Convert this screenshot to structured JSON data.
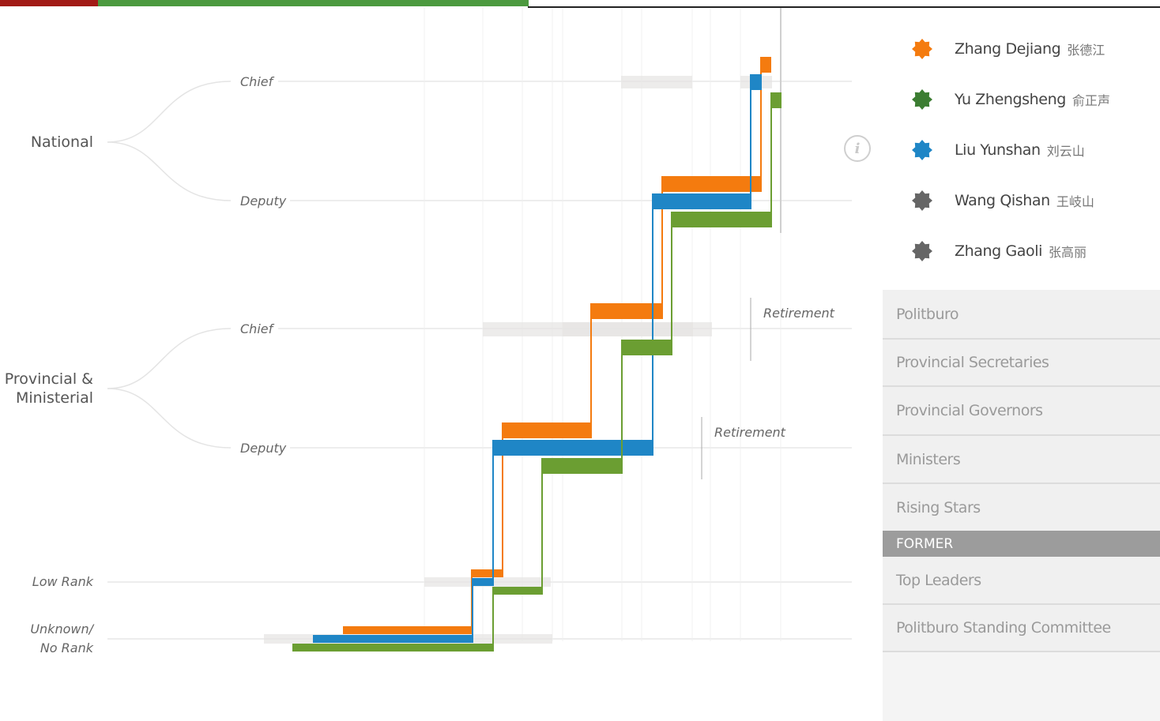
{
  "top_bar": {
    "colors": [
      "#a21b16",
      "#4c9a3f"
    ]
  },
  "chart_data": {
    "type": "step",
    "levels": [
      {
        "group": "National",
        "sub": "Chief"
      },
      {
        "group": "National",
        "sub": "Deputy"
      },
      {
        "group": "Provincial & Ministerial",
        "sub": "Chief"
      },
      {
        "group": "Provincial & Ministerial",
        "sub": "Deputy"
      },
      {
        "group": "",
        "sub": "Low Rank"
      },
      {
        "group": "",
        "sub": "Unknown/ No Rank"
      }
    ],
    "group_labels": {
      "national": "National",
      "provincial_line1": "Provincial &",
      "provincial_line2": "Ministerial"
    },
    "tier_labels": {
      "chief": "Chief",
      "deputy": "Deputy"
    },
    "rank_labels": {
      "low_rank": "Low Rank",
      "unknown_line1": "Unknown/",
      "unknown_line2": "No Rank"
    },
    "annotations": [
      "Retirement",
      "Retirement"
    ],
    "series": [
      {
        "name": "Zhang Dejiang",
        "color": "#f47b0f"
      },
      {
        "name": "Liu Yunshan",
        "color": "#1f86c6"
      },
      {
        "name": "Yu Zhengsheng",
        "color": "#6b9e32"
      }
    ]
  },
  "legend": {
    "items": [
      {
        "name": "Zhang Dejiang",
        "cn": "张德江",
        "color": "#f47b0f"
      },
      {
        "name": "Yu Zhengsheng",
        "cn": "俞正声",
        "color": "#3c7d32"
      },
      {
        "name": "Liu Yunshan",
        "cn": "刘云山",
        "color": "#1f86c6"
      },
      {
        "name": "Wang Qishan",
        "cn": "王岐山",
        "color": "#666666"
      },
      {
        "name": "Zhang Gaoli",
        "cn": "张高丽",
        "color": "#666666"
      }
    ]
  },
  "menu": {
    "items": [
      "Politburo",
      "Provincial Secretaries",
      "Provincial Governors",
      "Ministers",
      "Rising Stars"
    ],
    "section_header": "FORMER",
    "former_items": [
      "Top Leaders",
      "Politburo Standing Committee"
    ]
  },
  "info_button": {
    "glyph": "i"
  }
}
